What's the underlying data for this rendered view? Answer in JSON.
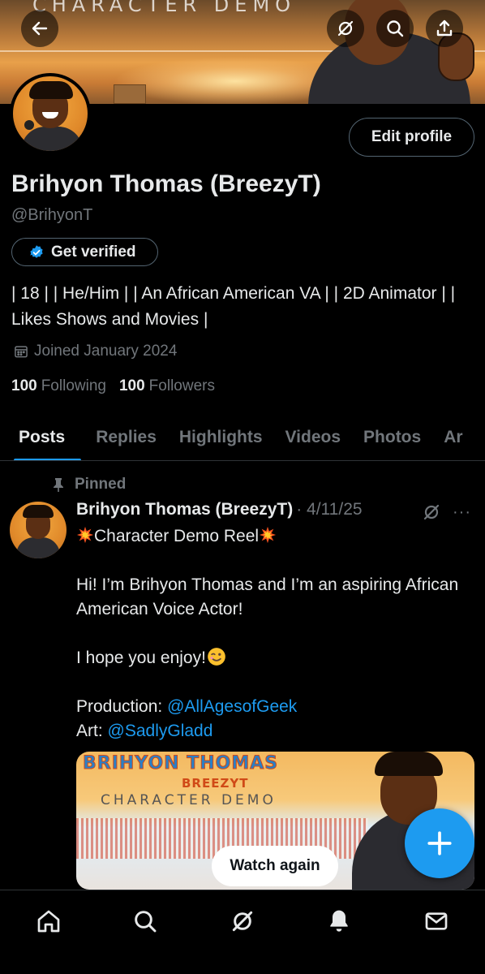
{
  "banner": {
    "title_text": "CHARACTER DEMO"
  },
  "header_actions": {
    "back_icon": "arrow-left-icon",
    "grok_icon": "grok-icon",
    "search_icon": "search-icon",
    "share_icon": "share-icon"
  },
  "profile": {
    "edit_label": "Edit profile",
    "name": "Brihyon Thomas (BreezyT)",
    "handle": "@BrihyonT",
    "verify_label": "Get verified",
    "bio": "| 18 | | He/Him | | An African American VA | | 2D Animator | | Likes Shows and Movies |",
    "joined": "Joined January 2024",
    "following_count": "100",
    "following_label": "Following",
    "followers_count": "100",
    "followers_label": "Followers"
  },
  "tabs": [
    {
      "label": "Posts",
      "active": true
    },
    {
      "label": "Replies"
    },
    {
      "label": "Highlights"
    },
    {
      "label": "Videos"
    },
    {
      "label": "Photos"
    },
    {
      "label": "Ar"
    }
  ],
  "post": {
    "pinned_label": "Pinned",
    "author": "Brihyon Thomas (BreezyT)",
    "date": "· 4/11/25",
    "more": "···",
    "line1": "Character Demo Reel",
    "line2": "Hi! I’m Brihyon Thomas and I’m an aspiring African American Voice Actor!",
    "line3": "I hope you enjoy!",
    "production_label": "Production: ",
    "production_link": "@AllAgesofGeek",
    "art_label": "Art: ",
    "art_link": "@SadlyGladd",
    "media": {
      "title": "BRIHYON THOMAS",
      "subtitle": "BREEZYT",
      "demo": "CHARACTER DEMO"
    },
    "watch_again": "Watch again"
  },
  "fab_icon": "plus-icon",
  "bottom_nav": [
    "home-icon",
    "search-icon",
    "grok-icon",
    "notifications-icon",
    "messages-icon"
  ],
  "colors": {
    "accent": "#1d9bf0",
    "background": "#000000",
    "text": "#e7e9ea",
    "muted": "#71767b"
  }
}
